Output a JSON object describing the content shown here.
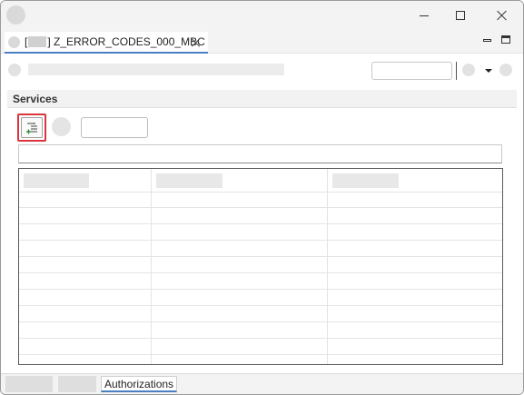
{
  "window": {
    "controls": {
      "minimize": "minimize",
      "maximize": "maximize",
      "close": "close"
    }
  },
  "editor_tab": {
    "prefix": "[",
    "suffix": "] Z_ERROR_CODES_000_MBC"
  },
  "section": {
    "title": "Services"
  },
  "table": {
    "columns": 3,
    "rows": 11
  },
  "bottom_tabs": {
    "active_label": "Authorizations"
  },
  "colors": {
    "highlight_border": "#d9363e",
    "tab_accent": "#4a7fc2"
  },
  "icons": {
    "add_button": "add-list-item-icon"
  }
}
